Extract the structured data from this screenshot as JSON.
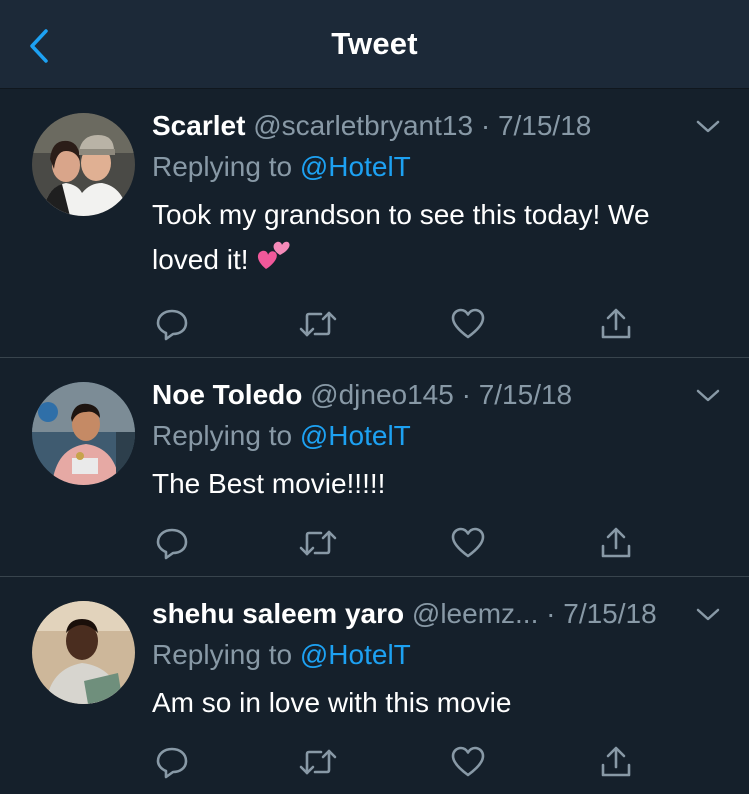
{
  "header": {
    "title": "Tweet",
    "back_icon": "chevron-left-icon"
  },
  "colors": {
    "background": "#15202b",
    "header": "#1c2938",
    "accent": "#1da1f2",
    "muted": "#8899a6",
    "divider": "#38444d"
  },
  "tweets": [
    {
      "name": "Scarlet",
      "handle": "@scarletbryant13",
      "dot": "·",
      "date": "7/15/18",
      "replying_prefix": "Replying to ",
      "replying_to": "@HotelT",
      "text_line1": "Took my grandson to see this today! We",
      "text_line2": "loved it!",
      "emoji": "two-hearts-icon"
    },
    {
      "name": "Noe Toledo",
      "handle": "@djneo145",
      "dot": "·",
      "date": "7/15/18",
      "replying_prefix": "Replying to ",
      "replying_to": "@HotelT",
      "text": "The Best movie!!!!!"
    },
    {
      "name": "shehu saleem yaro",
      "handle": "@leemz...",
      "dot": "·",
      "date": "7/15/18",
      "replying_prefix": "Replying to ",
      "replying_to": "@HotelT",
      "text": "Am so in love with this movie"
    }
  ],
  "actions": [
    "reply-icon",
    "retweet-icon",
    "like-icon",
    "share-icon"
  ]
}
